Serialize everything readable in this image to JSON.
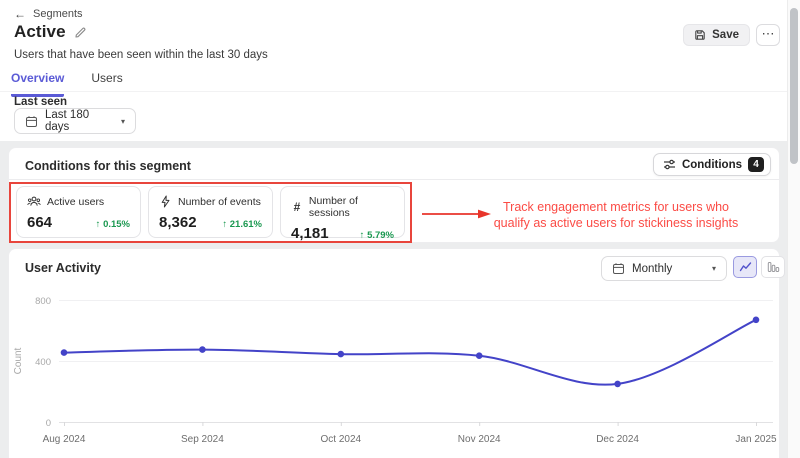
{
  "icons": {
    "back_arrow": "←",
    "ellipsis": "⋯",
    "chevron_down": "▾",
    "hash": "#",
    "up_arrow": "↑"
  },
  "header": {
    "breadcrumb": "Segments",
    "title": "Active",
    "subtitle": "Users that have been seen within the last 30 days",
    "save_label": "Save"
  },
  "tabs": [
    {
      "label": "Overview",
      "active": true
    },
    {
      "label": "Users",
      "active": false
    }
  ],
  "filter": {
    "label": "Last seen",
    "value": "Last 180 days"
  },
  "conditions": {
    "title": "Conditions for this segment",
    "button_label": "Conditions",
    "badge_count": "4",
    "metrics": [
      {
        "icon": "users-icon",
        "label": "Active users",
        "value": "664",
        "change": "0.15%",
        "direction": "up"
      },
      {
        "icon": "lightning-icon",
        "label": "Number of events",
        "value": "8,362",
        "change": "21.61%",
        "direction": "up"
      },
      {
        "icon": "hash-icon",
        "label": "Number of sessions",
        "value": "4,181",
        "change": "5.79%",
        "direction": "up"
      }
    ]
  },
  "annotation": {
    "line1": "Track engagement metrics for users who",
    "line2": "qualify as active users for stickiness insights"
  },
  "activity": {
    "title": "User Activity",
    "period_value": "Monthly"
  },
  "chart_data": {
    "type": "line",
    "title": "User Activity",
    "x": [
      "Aug 2024",
      "Sep 2024",
      "Oct 2024",
      "Nov 2024",
      "Dec 2024",
      "Jan 2025"
    ],
    "values": [
      455,
      475,
      445,
      435,
      250,
      670
    ],
    "ylabel": "Count",
    "xlabel": "",
    "yticks": [
      0,
      400,
      800
    ],
    "ylim": [
      0,
      800
    ],
    "grid": true,
    "legend": "none",
    "line_color": "#4343c8"
  },
  "colors": {
    "accent": "#5b5bd6",
    "line": "#4343c8",
    "positive": "#1a9850",
    "annotation_box": "#e8453c",
    "annotation_text": "#fb4b45",
    "badge": "#1f1f1f"
  }
}
